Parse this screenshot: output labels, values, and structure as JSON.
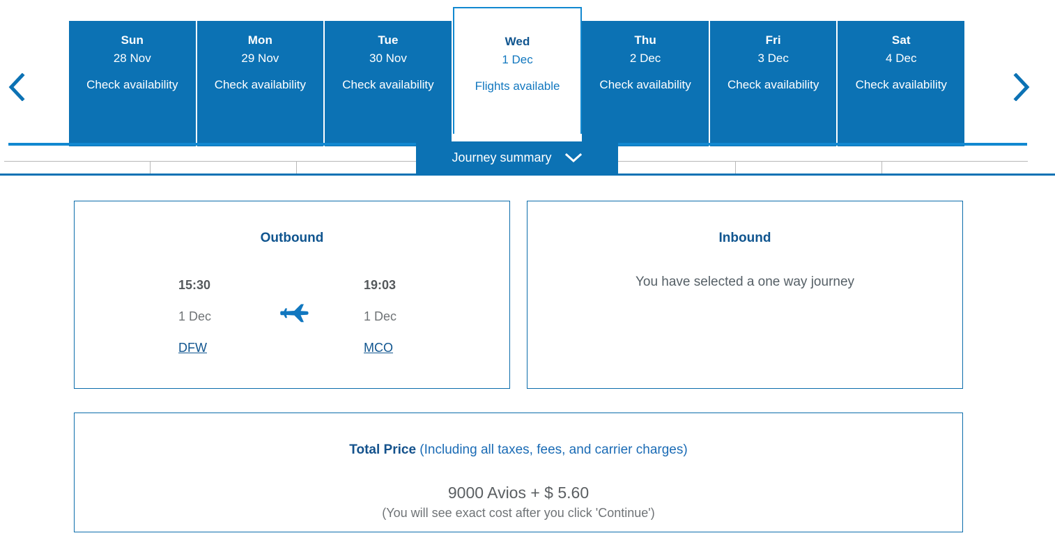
{
  "date_selector": {
    "prev_label": "Previous dates",
    "next_label": "Next dates",
    "prev_icon": "chevron-left-icon",
    "next_icon": "chevron-right-icon",
    "accent_color": "#0c72b4",
    "selected_index": 3,
    "days": [
      {
        "dow": "Sun",
        "dom": "28 Nov",
        "status": "Check availability",
        "selected": false
      },
      {
        "dow": "Mon",
        "dom": "29 Nov",
        "status": "Check availability",
        "selected": false
      },
      {
        "dow": "Tue",
        "dom": "30 Nov",
        "status": "Check availability",
        "selected": false
      },
      {
        "dow": "Wed",
        "dom": "1 Dec",
        "status": "Flights available",
        "selected": true
      },
      {
        "dow": "Thu",
        "dom": "2 Dec",
        "status": "Check availability",
        "selected": false
      },
      {
        "dow": "Fri",
        "dom": "3 Dec",
        "status": "Check availability",
        "selected": false
      },
      {
        "dow": "Sat",
        "dom": "4 Dec",
        "status": "Check availability",
        "selected": false
      }
    ]
  },
  "journey_summary": {
    "label": "Journey summary",
    "chevron_icon": "chevron-down-icon",
    "expanded": true
  },
  "outbound": {
    "title": "Outbound",
    "plane_icon": "airplane-icon",
    "depart": {
      "time": "15:30",
      "date": "1 Dec",
      "code": "DFW"
    },
    "arrive": {
      "time": "19:03",
      "date": "1 Dec",
      "code": "MCO"
    }
  },
  "inbound": {
    "title": "Inbound",
    "message": "You have selected a one way journey"
  },
  "total_price": {
    "heading_strong": "Total Price",
    "heading_light": "(Including all taxes, fees, and carrier charges)",
    "amount": "9000 Avios + $ 5.60",
    "note": "(You will see exact cost after you click 'Continue')"
  }
}
